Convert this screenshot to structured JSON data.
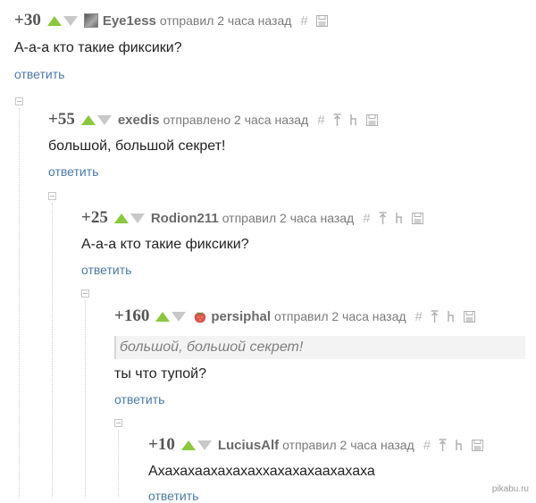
{
  "comments": [
    {
      "rating": "+30",
      "author": "Eye1ess",
      "meta": "отправил 2 часа назад",
      "text": "А-а-а кто такие фиксики?",
      "reply": "ответить",
      "avatar": "gray-avatar-icon"
    },
    {
      "rating": "+55",
      "author": "exedis",
      "meta": "отправлено 2 часа назад",
      "text": "большой, большой секрет!",
      "reply": "ответить"
    },
    {
      "rating": "+25",
      "author": "Rodion211",
      "meta": "отправил 2 часа назад",
      "text": "А-а-а кто такие фиксики?",
      "reply": "ответить"
    },
    {
      "rating": "+160",
      "author": "persiphal",
      "meta": "отправил 2 часа назад",
      "quote": "большой, большой секрет!",
      "text": "ты что тупой?",
      "reply": "ответить",
      "avatar": "strawberry-avatar-icon"
    },
    {
      "rating": "+10",
      "author": "LuciusAlf",
      "meta": "отправил 2 часа назад",
      "text": "Ахахахаахахахаххахахахаахахаха",
      "reply": "ответить"
    }
  ],
  "symbols": {
    "hash": "#"
  },
  "watermark": "pikabu.ru",
  "colors": {
    "vote_up": "#8ac73f",
    "vote_down": "#c8c8c8",
    "reply_link": "#4a79a8"
  }
}
